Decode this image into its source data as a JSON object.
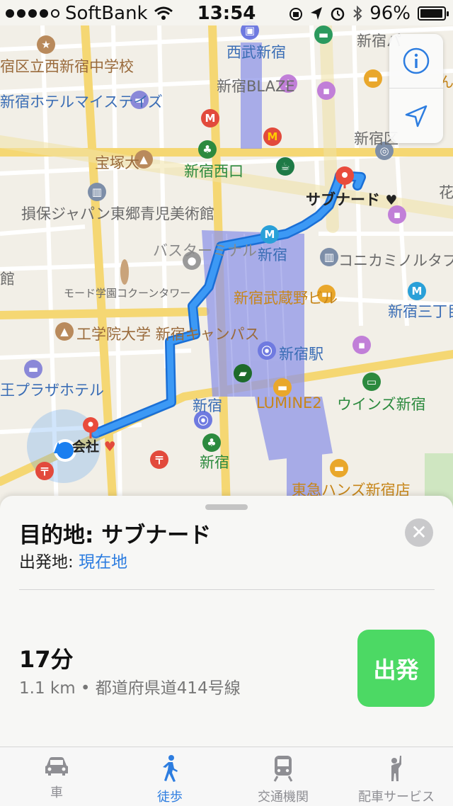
{
  "status_bar": {
    "carrier": "SoftBank",
    "time": "13:54",
    "battery": "96%",
    "battery_level": 0.96
  },
  "map": {
    "labels": {
      "school": "宿区立西新宿中学校",
      "hotel_mystays": "新宿ホテルマイステイズ",
      "seibu_shinjuku": "西武新宿",
      "blaze": "新宿BLAZE",
      "shinjuku_pa": "新宿パ",
      "shinjuku_ku": "新宿区",
      "hanazono": "花園",
      "takara": "宝塚大",
      "nishiguchi": "新宿西口",
      "subnard": "サブナード",
      "sonpo": "損保ジャパン東郷青児美術館",
      "bus_terminal": "バスターミナル",
      "shinjuku_metro": "新宿",
      "konica": "コニカミノルタプラザ",
      "mode_gakuen": "モード学園コクーンタワー",
      "musashino": "新宿武蔵野ビル",
      "sanchome": "新宿三丁目",
      "kogakuin": "工学院大学 新宿キャンパス",
      "shinjuku_station": "新宿駅",
      "keio_plaza": "王プラザホテル",
      "shinjuku_jr": "新宿",
      "lumine2": "LUMINE2",
      "wins": "ウインズ新宿",
      "kaisha": "会社",
      "shinjuku_south": "新宿",
      "tokyu_hands": "東急ハンズ新宿店",
      "edge_kan": "館",
      "edge_n": "ん"
    }
  },
  "sheet": {
    "destination_title": "目的地: サブナード",
    "origin_label": "出発地: ",
    "origin_value": "現在地",
    "eta": "17分",
    "route_detail": "1.1 km • 都道府県道414号線",
    "go_label": "出発"
  },
  "tabs": [
    {
      "label": "車",
      "icon": "car-icon"
    },
    {
      "label": "徒歩",
      "icon": "walk-icon"
    },
    {
      "label": "交通機関",
      "icon": "train-icon"
    },
    {
      "label": "配車サービス",
      "icon": "ride-share-icon"
    }
  ],
  "active_tab": "徒歩",
  "colors": {
    "accent": "#2d7de0",
    "route": "#2e8df0",
    "go_button": "#4cd964",
    "pin": "#e94b3c"
  }
}
